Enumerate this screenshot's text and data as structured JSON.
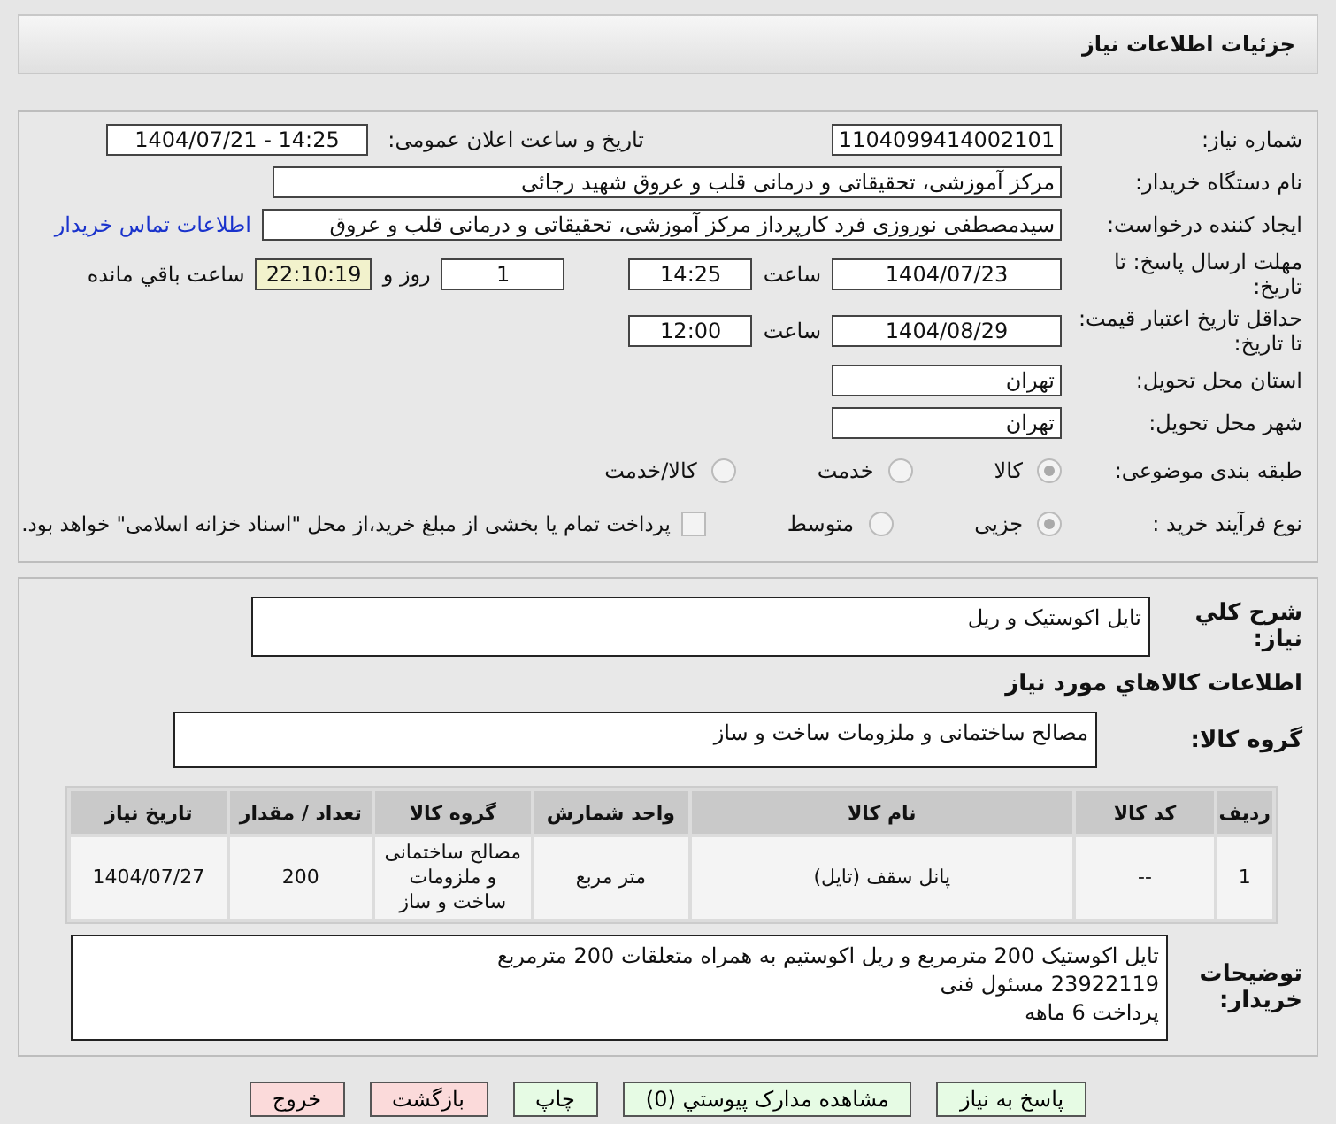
{
  "header": {
    "title": "جزئیات اطلاعات نیاز"
  },
  "need_number": {
    "label": "شماره نیاز:",
    "value": "1104099414002101"
  },
  "announce": {
    "label": "تاریخ و ساعت اعلان عمومی:",
    "value": "1404/07/21 - 14:25"
  },
  "buyer": {
    "label": "نام دستگاه خریدار:",
    "value": "مرکز آموزشی، تحقیقاتی و درمانی قلب و عروق شهید رجائی"
  },
  "creator": {
    "label": "ایجاد کننده درخواست:",
    "value": "سیدمصطفی نوروزی فرد کارپرداز مرکز آموزشی، تحقیقاتی و درمانی قلب و عروق",
    "link": "اطلاعات تماس خریدار"
  },
  "deadline": {
    "label": "مهلت ارسال پاسخ: تا تاریخ:",
    "date": "1404/07/23",
    "time_label": "ساعت",
    "time": "14:25",
    "days": "1",
    "days_label": "روز و",
    "remaining": "22:10:19",
    "remaining_label": "ساعت باقي مانده"
  },
  "validity": {
    "label": "حداقل تاریخ اعتبار قیمت: تا تاریخ:",
    "date": "1404/08/29",
    "time_label": "ساعت",
    "time": "12:00"
  },
  "province": {
    "label": "استان محل تحویل:",
    "value": "تهران"
  },
  "city": {
    "label": "شهر محل تحویل:",
    "value": "تهران"
  },
  "category": {
    "label": "طبقه بندی موضوعی:",
    "options": [
      {
        "label": "کالا",
        "selected": true
      },
      {
        "label": "خدمت",
        "selected": false
      },
      {
        "label": "کالا/خدمت",
        "selected": false
      }
    ]
  },
  "process": {
    "label": "نوع فرآیند خرید :",
    "options": [
      {
        "label": "جزیی",
        "selected": true
      },
      {
        "label": "متوسط",
        "selected": false
      }
    ],
    "payment": {
      "checked": false,
      "text": "پرداخت تمام یا بخشی از مبلغ خرید،از محل \"اسناد خزانه اسلامی\" خواهد بود."
    }
  },
  "summary": {
    "label": "شرح کلي نياز:",
    "value": "تایل اکوستیک و ریل"
  },
  "goods_title": "اطلاعات کالاهاي مورد نياز",
  "goods_group": {
    "label": "گروه کالا:",
    "value": "مصالح ساختمانی و ملزومات ساخت و ساز"
  },
  "table": {
    "columns": [
      "ردیف",
      "کد کالا",
      "نام کالا",
      "واحد شمارش",
      "گروه کالا",
      "تعداد / مقدار",
      "تاریخ نیاز"
    ],
    "rows": [
      [
        "1",
        "--",
        "پانل سقف (تایل)",
        "متر مربع",
        "مصالح ساختمانی و ملزومات ساخت و ساز",
        "200",
        "1404/07/27"
      ]
    ]
  },
  "notes": {
    "label": "توضیحات خریدار:",
    "lines": [
      "تایل اکوستیک 200 مترمربع و ریل اکوستیم به همراه متعلقات 200 مترمربع",
      "23922119 مسئول فنی",
      "پرداخت 6 ماهه"
    ]
  },
  "buttons": [
    {
      "label": "پاسخ به نیاز",
      "kind": "green"
    },
    {
      "label": "مشاهده مدارک پیوستي (0)",
      "kind": "green"
    },
    {
      "label": "چاپ",
      "kind": "green"
    },
    {
      "label": "بازگشت",
      "kind": "red"
    },
    {
      "label": "خروج",
      "kind": "red"
    }
  ]
}
